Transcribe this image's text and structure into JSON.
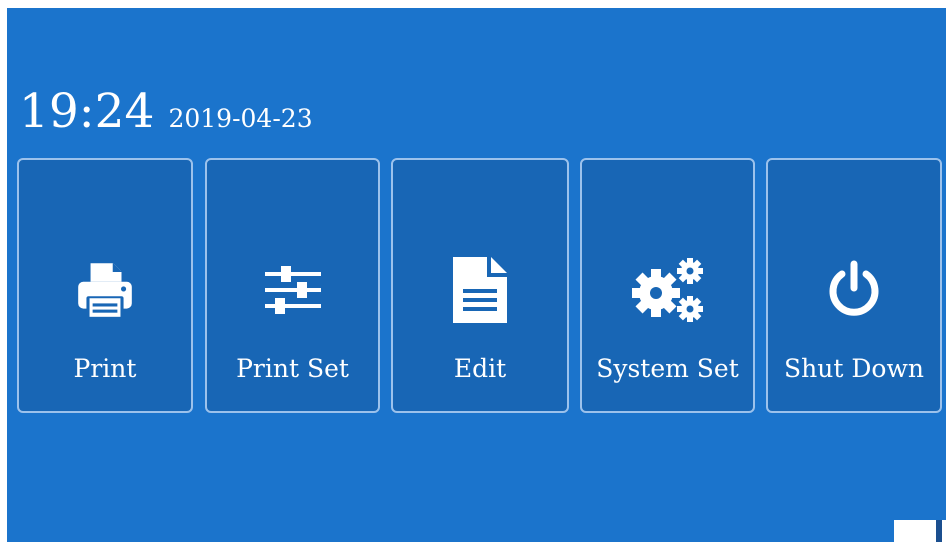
{
  "header": {
    "time": "19:24",
    "date": "2019-04-23"
  },
  "tiles": [
    {
      "label": "Print",
      "icon": "printer-icon"
    },
    {
      "label": "Print Set",
      "icon": "sliders-icon"
    },
    {
      "label": "Edit",
      "icon": "document-icon"
    },
    {
      "label": "System Set",
      "icon": "gears-icon"
    },
    {
      "label": "Shut Down",
      "icon": "power-icon"
    }
  ],
  "colors": {
    "background": "#1b74cc",
    "tile": "#1866b5",
    "tile_border": "#9cc2ec",
    "text": "#ffffff"
  }
}
